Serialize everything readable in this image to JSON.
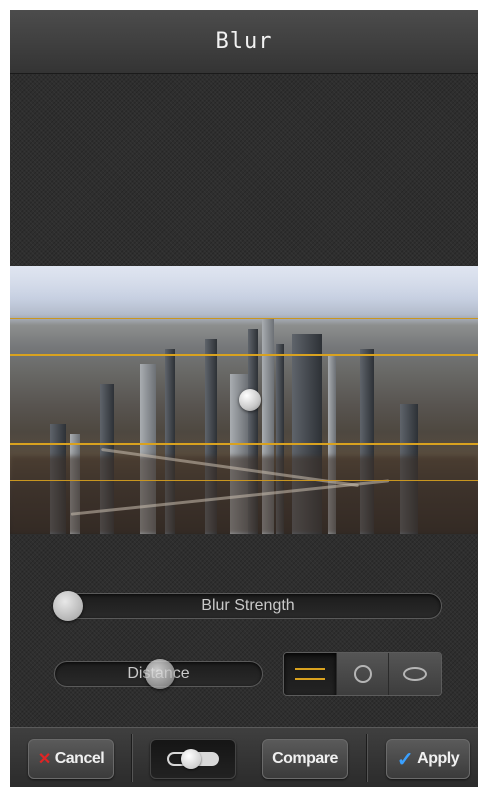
{
  "header": {
    "title": "Blur"
  },
  "controls": {
    "blur_strength_label": "Blur Strength",
    "blur_strength_value": 0.0,
    "distance_label": "Distance",
    "distance_value": 0.5
  },
  "modes": {
    "items": [
      {
        "id": "linear",
        "icon": "linear-blur-icon",
        "selected": true
      },
      {
        "id": "circle",
        "icon": "circle-blur-icon",
        "selected": false
      },
      {
        "id": "ellipse",
        "icon": "ellipse-blur-icon",
        "selected": false
      }
    ]
  },
  "toolbar": {
    "cancel_label": "Cancel",
    "compare_label": "Compare",
    "apply_label": "Apply"
  },
  "colors": {
    "guide_line": "#d9a21f",
    "cancel_icon": "#e02424",
    "apply_icon": "#3aa0ff"
  }
}
